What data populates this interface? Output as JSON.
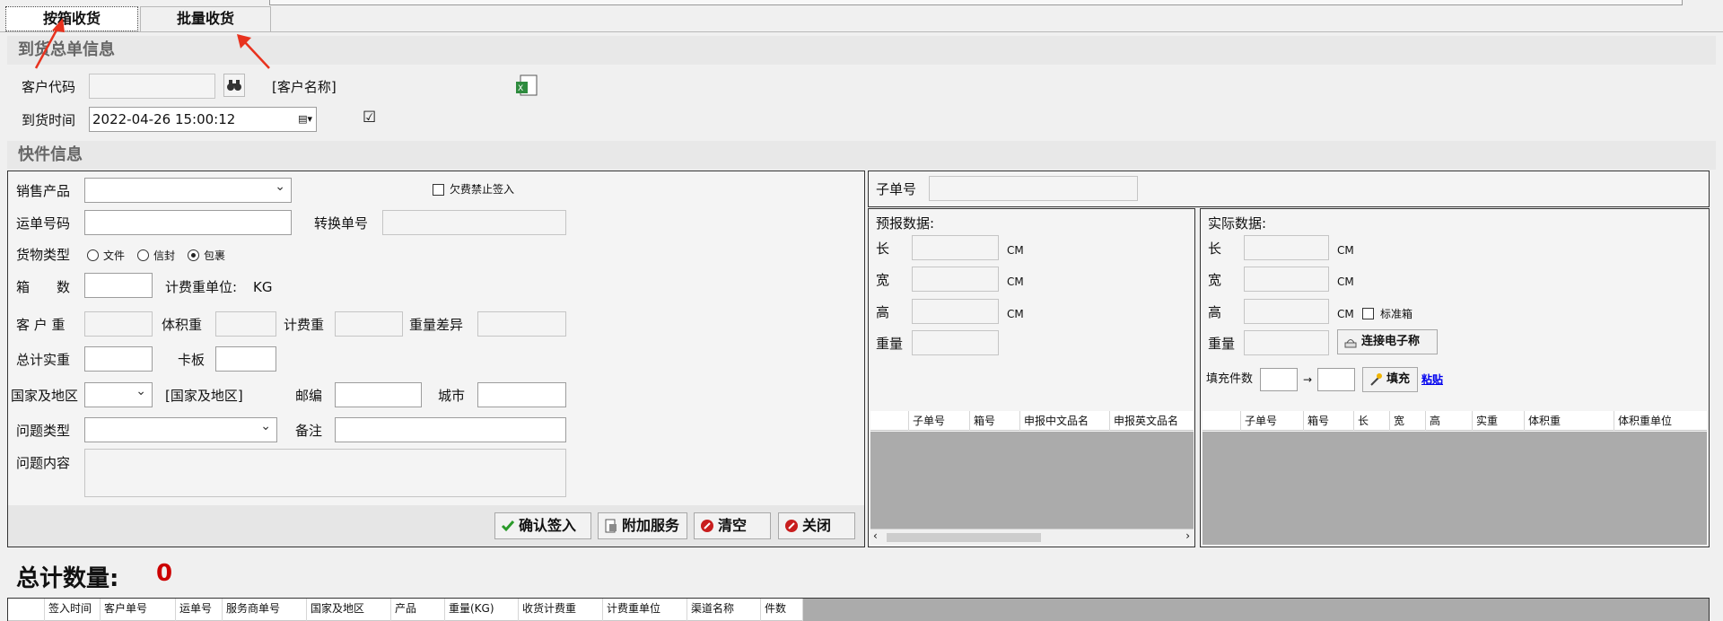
{
  "tabs": [
    {
      "label": "按箱收货",
      "active": true
    },
    {
      "label": "批量收货",
      "active": false
    }
  ],
  "summary": {
    "section_title": "到货总单信息",
    "customer_code_label": "客户代码",
    "customer_code_value": "",
    "customer_name_label": "[客户名称]",
    "arrival_time_label": "到货时间",
    "arrival_time_value": "2022-04-26 15:00:12",
    "arrival_checkbox": "☑"
  },
  "express": {
    "section_title": "快件信息",
    "sales_product_label": "销售产品",
    "sales_product_value": "",
    "arrears_block_label": "欠费禁止签入",
    "waybill_label": "运单号码",
    "waybill_value": "",
    "convert_no_label": "转换单号",
    "goods_type_label": "货物类型",
    "goods_types": [
      "文件",
      "信封",
      "包裹"
    ],
    "goods_type_selected": "包裹",
    "boxes_label": "箱　　数",
    "billing_unit_label": "计费重单位:",
    "billing_unit_value": "KG",
    "customer_weight_label": "客 户 重",
    "volume_weight_label": "体积重",
    "billing_weight_label": "计费重",
    "weight_diff_label": "重量差异",
    "total_actual_label": "总计实重",
    "pallet_label": "卡板",
    "country_label": "国家及地区",
    "country_name_label": "[国家及地区]",
    "postcode_label": "邮编",
    "city_label": "城市",
    "issue_type_label": "问题类型",
    "remark_label": "备注",
    "issue_content_label": "问题内容"
  },
  "buttons": {
    "confirm": "确认签入",
    "addon": "附加服务",
    "clear": "清空",
    "close": "关闭"
  },
  "sub_order": {
    "label": "子单号",
    "forecast_title": "预报数据:",
    "actual_title": "实际数据:",
    "length_label": "长",
    "width_label": "宽",
    "height_label": "高",
    "weight_label": "重量",
    "unit": "CM",
    "standard_box_label": "标准箱",
    "connect_scale_button": "连接电子称",
    "fill_count_label": "填充件数",
    "arrow": "→",
    "fill_button": "填充",
    "paste_link": "粘贴"
  },
  "forecast_grid_columns": [
    "子单号",
    "箱号",
    "申报中文品名",
    "申报英文品名"
  ],
  "actual_grid_columns": [
    "子单号",
    "箱号",
    "长",
    "宽",
    "高",
    "实重",
    "体积重",
    "体积重单位"
  ],
  "totals": {
    "label": "总计数量:",
    "value": "0"
  },
  "main_grid_columns": [
    "签入时间",
    "客户单号",
    "运单号",
    "服务商单号",
    "国家及地区",
    "产品",
    "重量(KG)",
    "收货计费重",
    "计费重单位",
    "渠道名称",
    "件数"
  ],
  "colors": {
    "total_value": "#cc0000",
    "link": "#0000ee",
    "arrow_annotation": "#e8321e"
  }
}
